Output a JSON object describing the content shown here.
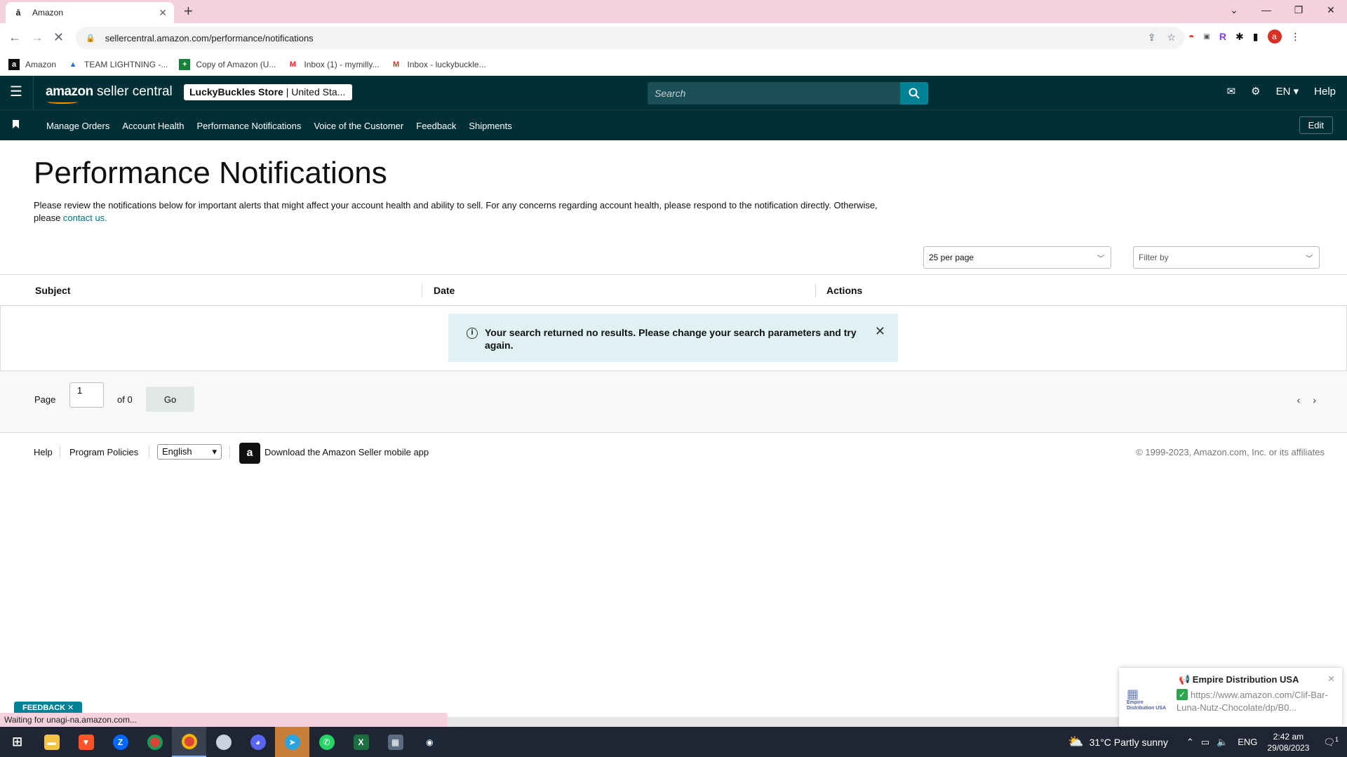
{
  "browser": {
    "tab_title": "Amazon",
    "url": "sellercentral.amazon.com/performance/notifications",
    "bookmarks": [
      "Amazon",
      "TEAM LIGHTNING -...",
      "Copy of Amazon (U...",
      "Inbox (1) - mymilly...",
      "Inbox - luckybuckle..."
    ],
    "status_text": "Waiting for unagi-na.amazon.com..."
  },
  "header": {
    "logo_main": "amazon",
    "logo_sub": "seller central",
    "store_name": "LuckyBuckles Store",
    "store_region": "| United Sta...",
    "search_placeholder": "Search",
    "language": "EN",
    "help": "Help"
  },
  "nav": {
    "items": [
      "Manage Orders",
      "Account Health",
      "Performance Notifications",
      "Voice of the Customer",
      "Feedback",
      "Shipments"
    ],
    "edit": "Edit"
  },
  "page": {
    "title": "Performance Notifications",
    "intro": "Please review the notifications below for important alerts that might affect your account health and ability to sell. For any concerns regarding account health, please respond to the notification directly. Otherwise, please ",
    "contact_link": "contact us.",
    "per_page": "25 per page",
    "filter_placeholder": "Filter by",
    "columns": [
      "Subject",
      "Date",
      "Actions"
    ],
    "alert": "Your search returned no results. Please change your search parameters and try again."
  },
  "pager": {
    "label": "Page",
    "value": "1",
    "of_text": "of 0",
    "go": "Go"
  },
  "footer": {
    "help": "Help",
    "policies": "Program Policies",
    "language": "English",
    "app_text": "Download the Amazon Seller mobile app",
    "copyright": "© 1999-2023, Amazon.com, Inc. or its affiliates"
  },
  "feedback_tab": "FEEDBACK ✕",
  "toast": {
    "title": "📢 Empire Distribution USA",
    "logo_text": "Empire Distribution USA",
    "url": "https://www.amazon.com/Clif-Bar-Luna-Nutz-Chocolate/dp/B0..."
  },
  "taskbar": {
    "weather": "31°C  Partly sunny",
    "lang": "ENG",
    "time": "2:42 am",
    "date": "29/08/2023",
    "notifications": "1"
  }
}
